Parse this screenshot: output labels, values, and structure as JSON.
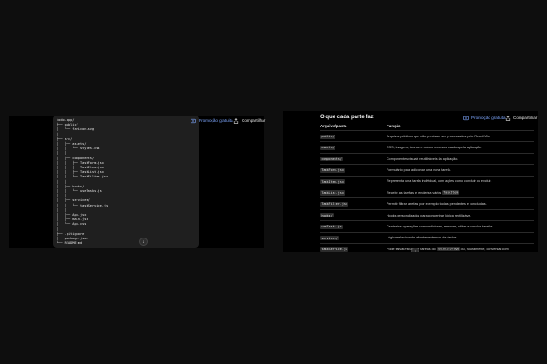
{
  "header": {
    "promo_label": "Promoção gratuita",
    "share_label": "Compartilhar"
  },
  "left": {
    "code_lines": [
      "todo-app/",
      "├── public/",
      "│   └── favicon.svg",
      "│",
      "├── src/",
      "│   ├── assets/",
      "│   │   └── styles.css",
      "│   │",
      "│   ├── components/",
      "│   │   ├── TaskForm.jsx",
      "│   │   ├── TaskItem.jsx",
      "│   │   ├── TaskList.jsx",
      "│   │   └── TaskFilter.jsx",
      "│   │",
      "│   ├── hooks/",
      "│   │   └── useTasks.js",
      "│   │",
      "│   ├── services/",
      "│   │   └── taskService.js",
      "│   │",
      "│   ├── App.jsx",
      "│   ├── main.jsx",
      "│   └── App.css",
      "│",
      "├── .gitignore",
      "├── package.json",
      "└── README.md"
    ]
  },
  "right": {
    "title": "O que cada parte faz",
    "col_file": "Arquivo/pasta",
    "col_func": "Função",
    "rows": [
      {
        "file": "public/",
        "desc": "Arquivos públicos que não precisam ser processados pelo React/Vite."
      },
      {
        "file": "assets/",
        "desc": "CSS, imagens, ícones e outros recursos usados pela aplicação."
      },
      {
        "file": "components/",
        "desc": "Componentes visuais reutilizáveis da aplicação."
      },
      {
        "file": "TaskForm.jsx",
        "desc": "Formulário para adicionar uma nova tarefa."
      },
      {
        "file": "TaskItem.jsx",
        "desc": "Representa uma tarefa individual, com ações como concluir ou excluir."
      },
      {
        "file": "TaskList.jsx",
        "desc_pre": "Recebe as tarefas e renderiza vários ",
        "desc_code": "TaskItem",
        "desc_post": "."
      },
      {
        "file": "TaskFilter.jsx",
        "desc": "Permite filtrar tarefas, por exemplo: todas, pendentes e concluídas."
      },
      {
        "file": "hooks/",
        "desc": "Hooks personalizados para concentrar lógica reutilizável."
      },
      {
        "file": "useTasks.js",
        "desc": "Centraliza operações como adicionar, remover, editar e concluir tarefas."
      },
      {
        "file": "services/",
        "desc": "Lógica relacionada a fontes externas de dados."
      },
      {
        "file": "taskService.js",
        "desc_pre": "Pode salvar/recuperar tarefas do ",
        "desc_code": "localStorage",
        "desc_post": " ou, futuramente, conversar com"
      }
    ]
  }
}
